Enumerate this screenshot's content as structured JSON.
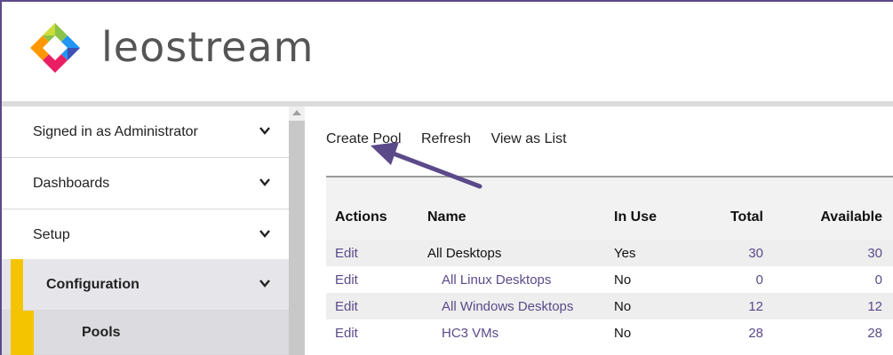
{
  "header": {
    "logo_text": "leostream"
  },
  "sidebar": {
    "items": [
      {
        "label": "Signed in as Administrator"
      },
      {
        "label": "Dashboards"
      },
      {
        "label": "Setup"
      },
      {
        "label": "Configuration"
      },
      {
        "label": "Pools"
      }
    ]
  },
  "toolbar": {
    "create_label": "Create Pool",
    "refresh_label": "Refresh",
    "view_label": "View as List"
  },
  "table": {
    "headers": [
      "Actions",
      "Name",
      "In Use",
      "Total",
      "Available"
    ],
    "rows": [
      {
        "action": "Edit",
        "name": "All Desktops",
        "in_use": "Yes",
        "total": "30",
        "available": "30"
      },
      {
        "action": "Edit",
        "name": "All Linux Desktops",
        "in_use": "No",
        "total": "0",
        "available": "0"
      },
      {
        "action": "Edit",
        "name": "All Windows Desktops",
        "in_use": "No",
        "total": "12",
        "available": "12"
      },
      {
        "action": "Edit",
        "name": "HC3 VMs",
        "in_use": "No",
        "total": "28",
        "available": "28"
      }
    ]
  },
  "colors": {
    "accent": "#5b4a8a",
    "highlight": "#f5c400"
  }
}
